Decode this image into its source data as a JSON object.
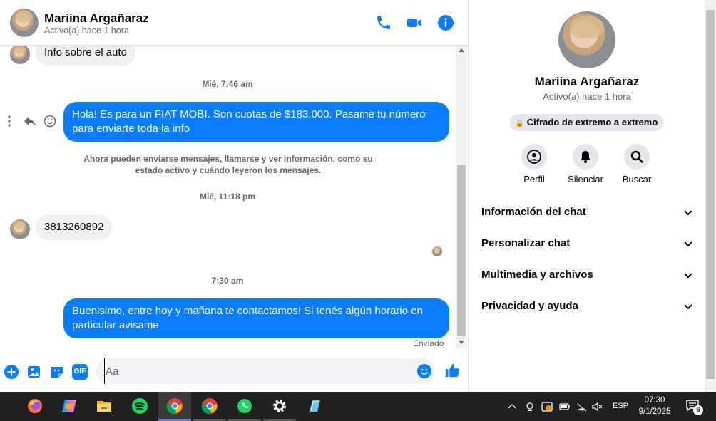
{
  "header": {
    "name": "Mariina Argañaraz",
    "status": "Activo(a) hace 1 hora"
  },
  "messages": {
    "msg1": "Info sobre el auto",
    "ts1": "Mié, 7:46 am",
    "msg2": "Hola! Es para un FIAT MOBI. Son cuotas de $183.000. Pasame tu número para enviarte toda la info",
    "notice": "Ahora pueden enviarse mensajes, llamarse y ver información, como su estado activo y cuándo leyeron los mensajes.",
    "ts2": "Mié, 11:18 pm",
    "msg3": "3813260892",
    "ts3": "7:30 am",
    "msg4": "Buenisimo, entre hoy y mañana te contactamos! Si tenés algún horario en particular avisame",
    "sent": "Enviado"
  },
  "composer": {
    "placeholder": "Aa",
    "gif": "GIF"
  },
  "info": {
    "name": "Mariina Argañaraz",
    "status": "Activo(a) hace 1 hora",
    "e2e": "Cifrado de extremo a extremo",
    "actions": [
      "Perfil",
      "Silenciar",
      "Buscar"
    ],
    "sections": [
      "Información del chat",
      "Personalizar chat",
      "Multimedia y archivos",
      "Privacidad y ayuda"
    ]
  },
  "taskbar": {
    "lang": "ESP",
    "time": "07:30",
    "date": "9/1/2025",
    "notifications": "6"
  },
  "colors": {
    "accent": "#0a7cff",
    "bubble_in": "#f0f0f0"
  }
}
